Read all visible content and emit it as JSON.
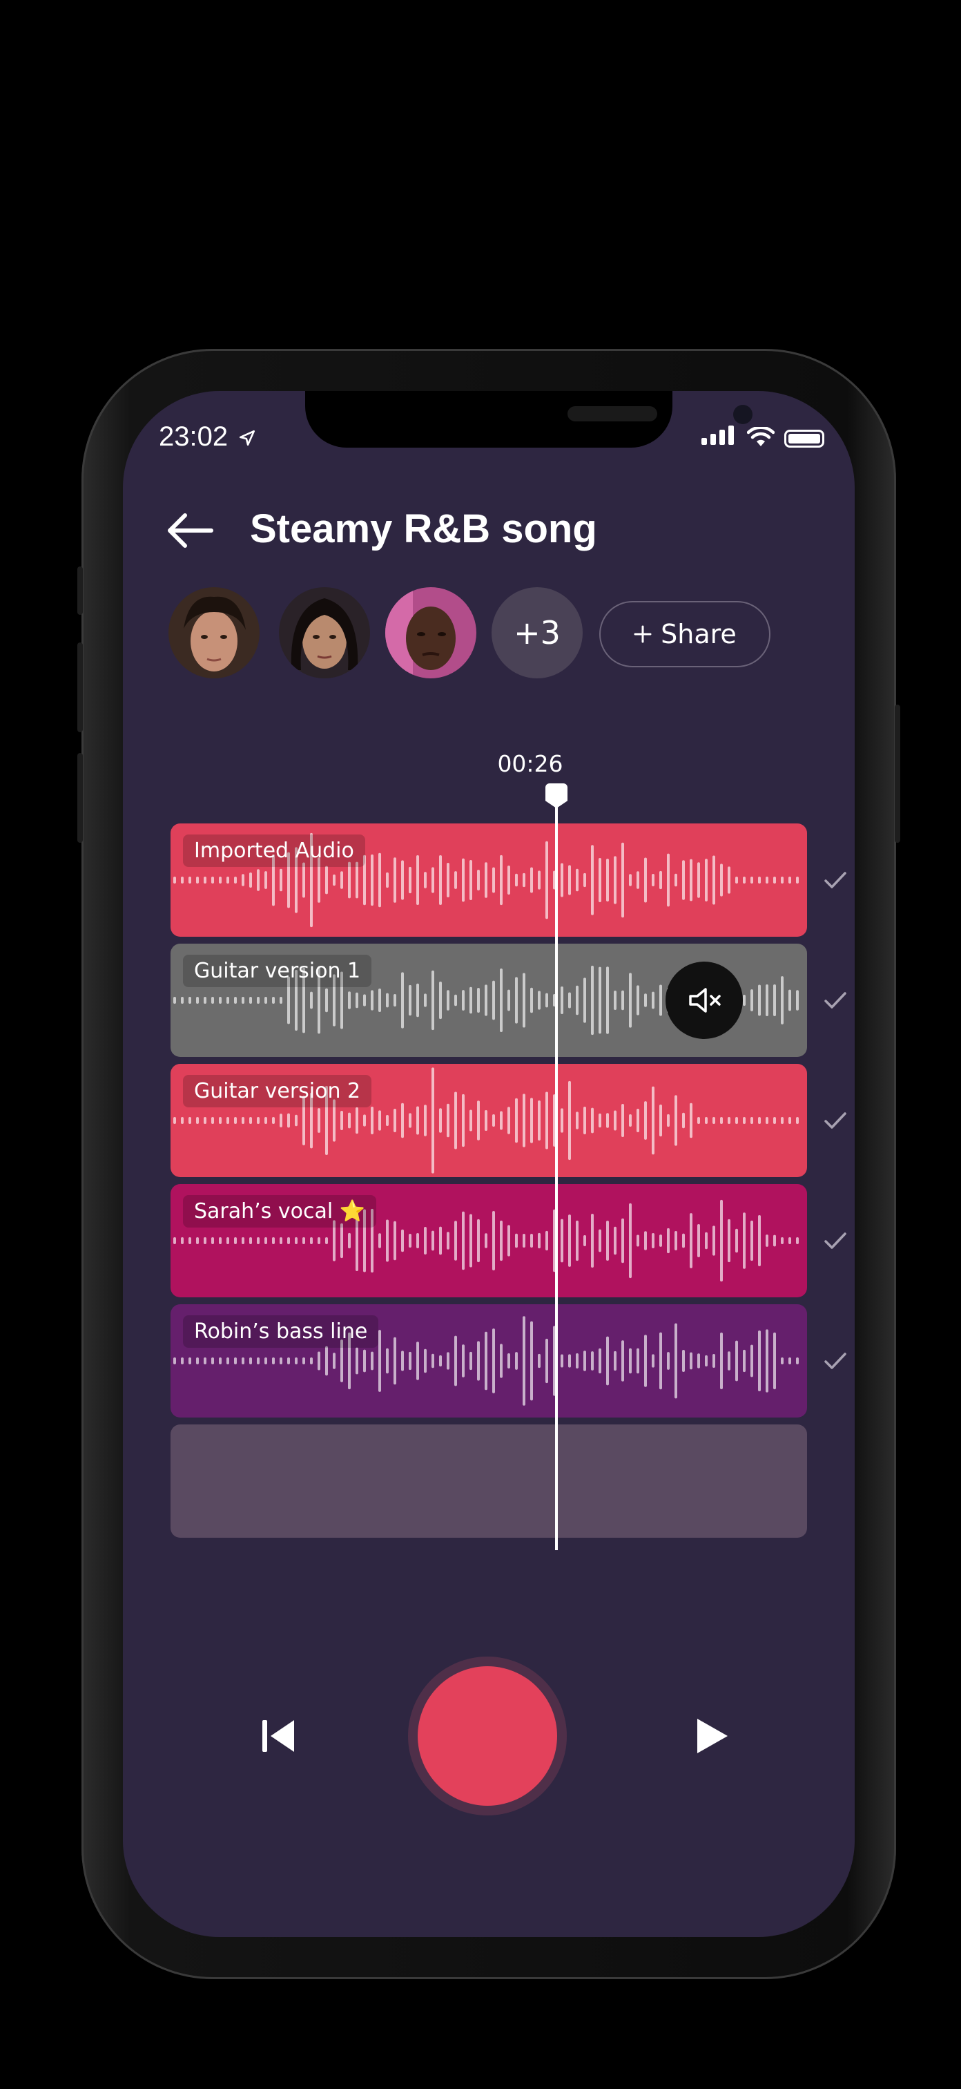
{
  "status": {
    "time": "23:02"
  },
  "header": {
    "title": "Steamy R&B song"
  },
  "collaborators": {
    "more_count": "+3",
    "share_label": "Share"
  },
  "timeline": {
    "current_time": "00:26"
  },
  "tracks": [
    {
      "label": "Imported Audio",
      "color": "#e0405a",
      "muted": false
    },
    {
      "label": "Guitar version 1",
      "color": "#6c6c6c",
      "muted": true
    },
    {
      "label": "Guitar version 2",
      "color": "#e0405a",
      "muted": false
    },
    {
      "label": "Sarah’s vocal ⭐",
      "color": "#b0125e",
      "muted": false
    },
    {
      "label": "Robin’s bass line",
      "color": "#651f6c",
      "muted": false
    }
  ],
  "icons": [
    "back-arrow-icon",
    "location-arrow-icon",
    "signal-icon",
    "wifi-icon",
    "battery-icon",
    "plus-icon",
    "mute-icon",
    "check-icon",
    "skip-back-icon",
    "play-icon"
  ]
}
